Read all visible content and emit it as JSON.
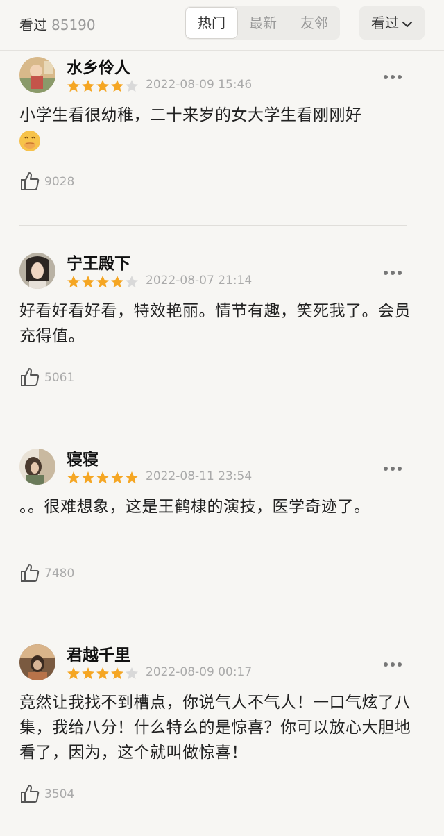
{
  "header": {
    "seen_label": "看过",
    "seen_count": "85190",
    "tabs": [
      {
        "label": "热门",
        "active": true
      },
      {
        "label": "最新",
        "active": false
      },
      {
        "label": "友邻",
        "active": false
      }
    ],
    "filter_label": "看过"
  },
  "colors": {
    "star_filled": "#f5a623",
    "star_empty": "#d9d9d9"
  },
  "reviews": [
    {
      "name": "水乡伶人",
      "rating": 4,
      "date": "2022-08-09 15:46",
      "text": "小学生看很幼稚，二十来岁的女大学生看刚刚好",
      "emoji": "face-with-hand-over-mouth",
      "likes": "9028"
    },
    {
      "name": "宁王殿下",
      "rating": 4,
      "date": "2022-08-07 21:14",
      "text": "好看好看好看，特效艳丽。情节有趣，笑死我了。会员充得值。",
      "likes": "5061"
    },
    {
      "name": "寝寝",
      "rating": 5,
      "date": "2022-08-11 23:54",
      "text": "。。很难想象，这是王鹤棣的演技，医学奇迹了。",
      "likes": "7480"
    },
    {
      "name": "君越千里",
      "rating": 4,
      "date": "2022-08-09 00:17",
      "text": "竟然让我找不到槽点，你说气人不气人！一口气炫了八集，我给八分！什么特么的是惊喜？你可以放心大胆地看了，因为，这个就叫做惊喜！",
      "likes": "3504"
    }
  ]
}
